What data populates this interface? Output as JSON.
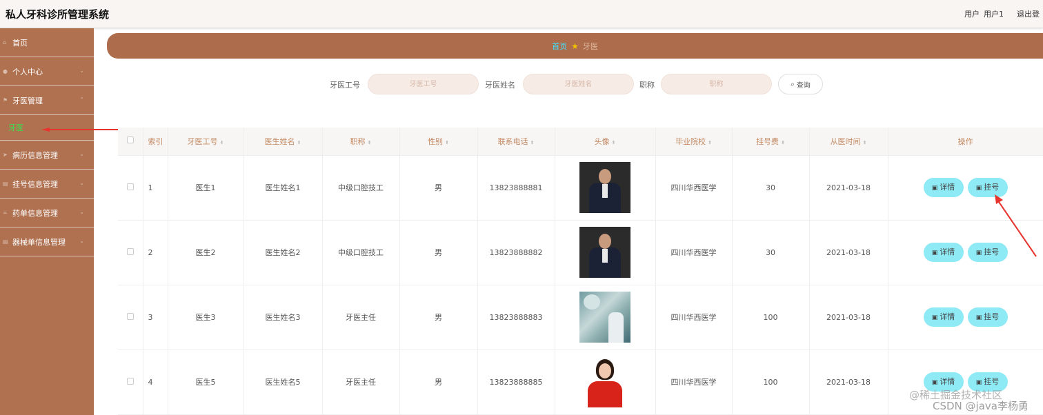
{
  "header": {
    "title": "私人牙科诊所管理系统",
    "user_label": "用户",
    "user_name": "用户1",
    "logout": "退出登"
  },
  "sidebar": {
    "items": [
      {
        "label": "首页",
        "icon": "home-icon"
      },
      {
        "label": "个人中心",
        "icon": "user-icon"
      },
      {
        "label": "牙医管理",
        "icon": "flag-icon"
      },
      {
        "label": "病历信息管理",
        "icon": "send-icon"
      },
      {
        "label": "挂号信息管理",
        "icon": "list-icon"
      },
      {
        "label": "药单信息管理",
        "icon": "link-icon"
      },
      {
        "label": "器械单信息管理",
        "icon": "list-icon"
      }
    ],
    "submenu_active": "牙医"
  },
  "breadcrumb": {
    "home": "首页",
    "current": "牙医"
  },
  "search": {
    "fields": [
      {
        "label": "牙医工号",
        "placeholder": "牙医工号"
      },
      {
        "label": "牙医姓名",
        "placeholder": "牙医姓名"
      },
      {
        "label": "职称",
        "placeholder": "职称"
      }
    ],
    "button": "查询"
  },
  "table": {
    "columns": [
      "索引",
      "牙医工号",
      "医生姓名",
      "职称",
      "性别",
      "联系电话",
      "头像",
      "毕业院校",
      "挂号费",
      "从医时间",
      "操作"
    ],
    "rows": [
      {
        "index": "1",
        "id": "医生1",
        "name": "医生姓名1",
        "title": "中级口腔技工",
        "gender": "男",
        "phone": "13823888881",
        "avatar": "suit",
        "school": "四川华西医学",
        "fee": "30",
        "since": "2021-03-18"
      },
      {
        "index": "2",
        "id": "医生2",
        "name": "医生姓名2",
        "title": "中级口腔技工",
        "gender": "男",
        "phone": "13823888882",
        "avatar": "suit",
        "school": "四川华西医学",
        "fee": "30",
        "since": "2021-03-18"
      },
      {
        "index": "3",
        "id": "医生3",
        "name": "医生姓名3",
        "title": "牙医主任",
        "gender": "男",
        "phone": "13823888883",
        "avatar": "clinic",
        "school": "四川华西医学",
        "fee": "100",
        "since": "2021-03-18"
      },
      {
        "index": "4",
        "id": "医生5",
        "name": "医生姓名5",
        "title": "牙医主任",
        "gender": "男",
        "phone": "13823888885",
        "avatar": "woman",
        "school": "四川华西医学",
        "fee": "100",
        "since": "2021-03-18"
      }
    ],
    "actions": {
      "detail": "详情",
      "register": "挂号"
    }
  },
  "watermark": {
    "line1": "@稀土掘金技术社区",
    "line2": "CSDN @java李杨勇"
  },
  "colors": {
    "sidebar": "#b07150",
    "accent_button": "#8eeaf5",
    "header_text_accent": "#c48a63",
    "annotation_arrow": "#e8342e"
  }
}
